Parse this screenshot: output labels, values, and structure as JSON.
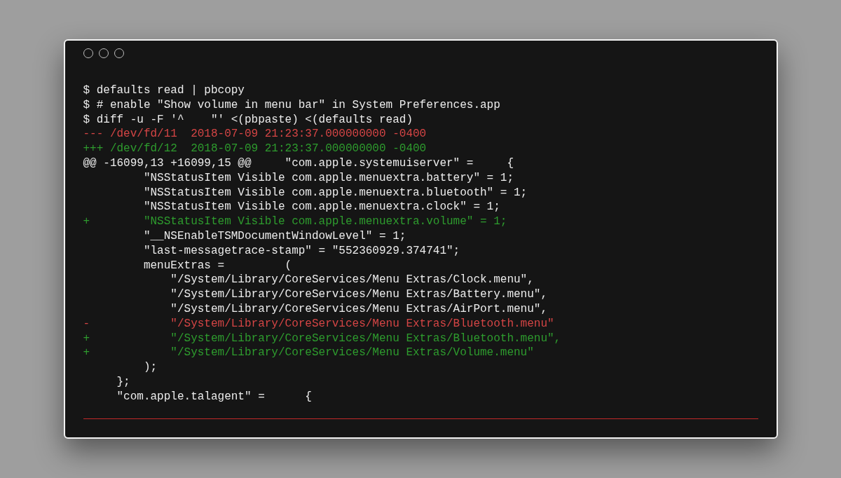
{
  "terminal": {
    "lines": [
      {
        "kind": "command",
        "text": "$ defaults read | pbcopy"
      },
      {
        "kind": "command",
        "text": "$ # enable \"Show volume in menu bar\" in System Preferences.app"
      },
      {
        "kind": "command",
        "text": "$ diff -u -F '^    \"' <(pbpaste) <(defaults read)"
      },
      {
        "kind": "removed",
        "text": "--- /dev/fd/11  2018-07-09 21:23:37.000000000 -0400"
      },
      {
        "kind": "added",
        "text": "+++ /dev/fd/12  2018-07-09 21:23:37.000000000 -0400"
      },
      {
        "kind": "context",
        "text": "@@ -16099,13 +16099,15 @@     \"com.apple.systemuiserver\" =     {"
      },
      {
        "kind": "context",
        "text": "         \"NSStatusItem Visible com.apple.menuextra.battery\" = 1;"
      },
      {
        "kind": "context",
        "text": "         \"NSStatusItem Visible com.apple.menuextra.bluetooth\" = 1;"
      },
      {
        "kind": "context",
        "text": "         \"NSStatusItem Visible com.apple.menuextra.clock\" = 1;"
      },
      {
        "kind": "added",
        "text": "+        \"NSStatusItem Visible com.apple.menuextra.volume\" = 1;"
      },
      {
        "kind": "context",
        "text": "         \"__NSEnableTSMDocumentWindowLevel\" = 1;"
      },
      {
        "kind": "context",
        "text": "         \"last-messagetrace-stamp\" = \"552360929.374741\";"
      },
      {
        "kind": "context",
        "text": "         menuExtras =         ("
      },
      {
        "kind": "context",
        "text": "             \"/System/Library/CoreServices/Menu Extras/Clock.menu\","
      },
      {
        "kind": "context",
        "text": "             \"/System/Library/CoreServices/Menu Extras/Battery.menu\","
      },
      {
        "kind": "context",
        "text": "             \"/System/Library/CoreServices/Menu Extras/AirPort.menu\","
      },
      {
        "kind": "removed",
        "text": "-            \"/System/Library/CoreServices/Menu Extras/Bluetooth.menu\""
      },
      {
        "kind": "added",
        "text": "+            \"/System/Library/CoreServices/Menu Extras/Bluetooth.menu\","
      },
      {
        "kind": "added",
        "text": "+            \"/System/Library/CoreServices/Menu Extras/Volume.menu\""
      },
      {
        "kind": "context",
        "text": "         );"
      },
      {
        "kind": "context",
        "text": "     };"
      },
      {
        "kind": "context",
        "text": "     \"com.apple.talagent\" =      {"
      }
    ]
  }
}
